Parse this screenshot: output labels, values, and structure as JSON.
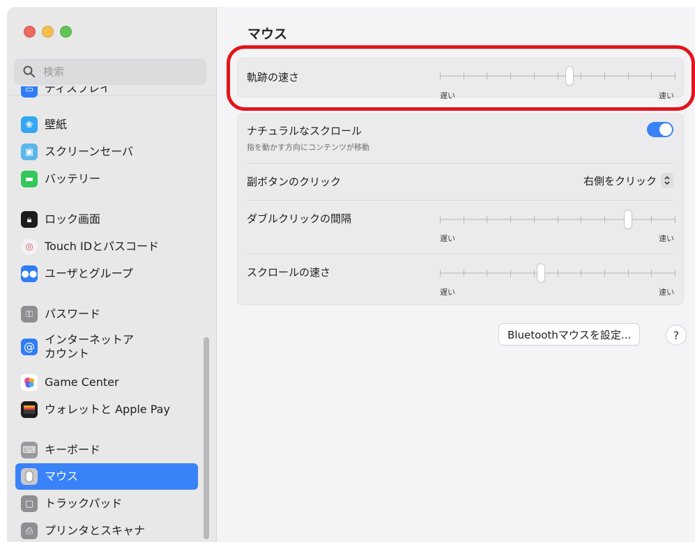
{
  "sidebar": {
    "search_placeholder": "検索",
    "items": [
      {
        "label": "ディスプレイ",
        "icon": "display-icon",
        "color": "#2f7cf6"
      },
      {
        "label": "壁紙",
        "icon": "wallpaper-icon",
        "color": "#35a7f2"
      },
      {
        "label": "スクリーンセーバ",
        "icon": "screensaver-icon",
        "color": "#5bb6ea"
      },
      {
        "label": "バッテリー",
        "icon": "battery-icon",
        "color": "#34c759"
      },
      {
        "label": "ロック画面",
        "icon": "lock-icon",
        "color": "#1c1c1e"
      },
      {
        "label": "Touch IDとパスコード",
        "icon": "fingerprint-icon",
        "color": "#f2f2f2"
      },
      {
        "label": "ユーザとグループ",
        "icon": "users-icon",
        "color": "#2f7cf6"
      },
      {
        "label": "パスワード",
        "icon": "key-icon",
        "color": "#8e8e93"
      },
      {
        "label": "インターネットアカウント",
        "icon": "at-icon",
        "color": "#2f7cf6"
      },
      {
        "label": "Game Center",
        "icon": "game-center-icon",
        "color": "#ffffff"
      },
      {
        "label": "ウォレットと Apple Pay",
        "icon": "wallet-icon",
        "color": "#1c1c1e"
      },
      {
        "label": "キーボード",
        "icon": "keyboard-icon",
        "color": "#9a9a9e"
      },
      {
        "label": "マウス",
        "icon": "mouse-icon",
        "color": "#8e8e93"
      },
      {
        "label": "トラックパッド",
        "icon": "trackpad-icon",
        "color": "#8e8e93"
      },
      {
        "label": "プリンタとスキャナ",
        "icon": "printer-icon",
        "color": "#8e8e93"
      }
    ],
    "selected": "マウス"
  },
  "main": {
    "title": "マウス",
    "tracking_speed": {
      "label": "軌跡の速さ",
      "min_label": "遅い",
      "max_label": "速い",
      "value": 0.55
    },
    "natural_scroll": {
      "label": "ナチュラルなスクロール",
      "sub": "指を動かす方向にコンテンツが移動",
      "on": true
    },
    "secondary_click": {
      "label": "副ボタンのクリック",
      "value": "右側をクリック"
    },
    "double_click": {
      "label": "ダブルクリックの間隔",
      "min_label": "遅い",
      "max_label": "速い",
      "value": 0.8
    },
    "scroll_speed": {
      "label": "スクロールの速さ",
      "min_label": "遅い",
      "max_label": "速い",
      "value": 0.43
    },
    "bluetooth_button": "Bluetoothマウスを設定...",
    "help": "?"
  },
  "colors": {
    "accent": "#3a82f7",
    "highlight": "#e3141b"
  }
}
